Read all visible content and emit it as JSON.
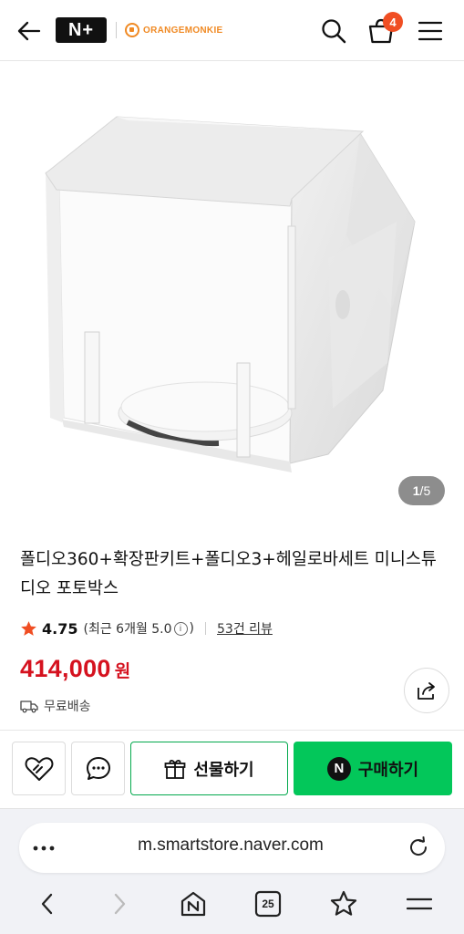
{
  "header": {
    "brand_primary": "N+",
    "brand_secondary": "ORANGEMONKIE",
    "cart_count": "4",
    "brand_color": "#f08a24",
    "icons": [
      "back-arrow-icon",
      "search-icon",
      "cart-icon",
      "hamburger-menu-icon"
    ]
  },
  "gallery": {
    "current": "1",
    "separator": " / ",
    "total": "5"
  },
  "product": {
    "title": "폴디오360+확장판키트+폴디오3+헤일로바세트 미니스튜디오 포토박스",
    "rating": "4.75",
    "recent_rating": "(최근 6개월 5.0",
    "recent_rating_close": ")",
    "info_glyph": "i",
    "reviews": "53건 리뷰",
    "price": "414,000",
    "price_unit": "원",
    "shipping": "무료배송",
    "price_color": "#d5121f"
  },
  "actions": {
    "gift_label": "선물하기",
    "buy_label": "구매하기",
    "naver_glyph": "N",
    "buy_color": "#03c75a"
  },
  "browser": {
    "url": "m.smartstore.naver.com",
    "tabs_count": "25"
  }
}
